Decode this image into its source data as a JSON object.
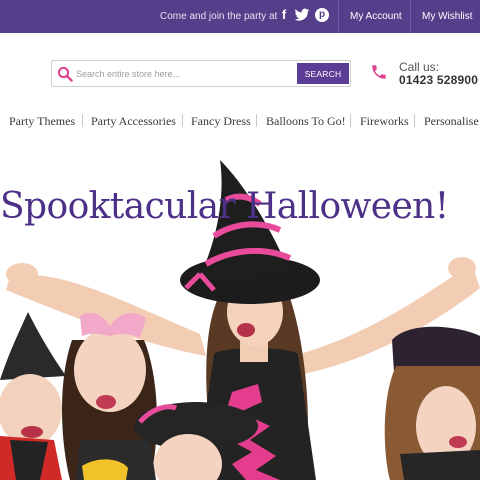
{
  "topbar": {
    "join_text": "Come and join the party at",
    "social": [
      {
        "icon": "facebook-icon",
        "glyph": "f"
      },
      {
        "icon": "twitter-icon",
        "glyph": "t"
      },
      {
        "icon": "pinterest-icon",
        "glyph": "p"
      }
    ],
    "links": [
      "My Account",
      "My Wishlist"
    ]
  },
  "search": {
    "placeholder": "Search entire store here...",
    "button_label": "SEARCH"
  },
  "contact": {
    "label": "Call us:",
    "phone": "01423 528900"
  },
  "nav": {
    "items": [
      "Party Themes",
      "Party Accessories",
      "Fancy Dress",
      "Balloons To Go!",
      "Fireworks",
      "Personalise"
    ]
  },
  "hero": {
    "title": "Spooktacular Halloween!"
  },
  "colors": {
    "brand_purple": "#553e8a",
    "accent_pink": "#e0438f",
    "title_purple": "#4d3087"
  }
}
